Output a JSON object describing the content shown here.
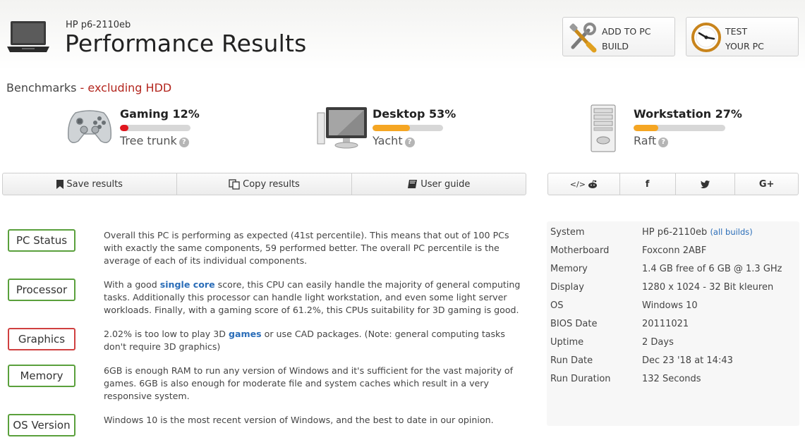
{
  "header": {
    "device_name": "HP p6-2110eb",
    "title": "Performance Results",
    "add_to_pc_build": "ADD TO PC\nBUILD",
    "test_your_pc": "TEST\nYOUR PC"
  },
  "benchmarks": {
    "heading": "Benchmarks",
    "separator": " - ",
    "excluding": "excluding HDD",
    "items": [
      {
        "title": "Gaming 12%",
        "percent": 12,
        "color": "#e0171e",
        "rank": "Tree trunk"
      },
      {
        "title": "Desktop 53%",
        "percent": 53,
        "color": "#f5a623",
        "rank": "Yacht"
      },
      {
        "title": "Workstation 27%",
        "percent": 27,
        "color": "#f5a623",
        "rank": "Raft"
      }
    ],
    "help_glyph": "?"
  },
  "toolbar": {
    "save": "Save results",
    "copy": "Copy results",
    "guide": "User guide"
  },
  "share": {
    "embed": "</>",
    "facebook": "f",
    "google": "G+"
  },
  "status": [
    {
      "label": "PC Status",
      "state": "good",
      "parts": [
        {
          "t": "Overall this PC is performing as expected (41st percentile). This means that out of 100 PCs with exactly the same components, 59 performed better. The overall PC percentile is the average of each of its individual components."
        }
      ]
    },
    {
      "label": "Processor",
      "state": "good",
      "parts": [
        {
          "t": "With a good "
        },
        {
          "t": "single core",
          "link": true
        },
        {
          "t": " score, this CPU can easily handle the majority of general computing tasks. Additionally this processor can handle light workstation, and even some light server workloads. Finally, with a gaming score of 61.2%, this CPUs suitability for 3D gaming is good."
        }
      ]
    },
    {
      "label": "Graphics",
      "state": "bad",
      "parts": [
        {
          "t": "2.02% is too low to play 3D "
        },
        {
          "t": "games",
          "link": true
        },
        {
          "t": " or use CAD packages. (Note: general computing tasks don't require 3D graphics)"
        }
      ]
    },
    {
      "label": "Memory",
      "state": "good",
      "parts": [
        {
          "t": "6GB is enough RAM to run any version of Windows and it's sufficient for the vast majority of games. 6GB is also enough for moderate file and system caches which result in a very responsive system."
        }
      ]
    },
    {
      "label": "OS Version",
      "state": "good",
      "parts": [
        {
          "t": "Windows 10 is the most recent version of Windows, and the best to date in our opinion."
        }
      ]
    }
  ],
  "specs": {
    "all_builds": "(all builds)",
    "rows": [
      {
        "key": "System",
        "value": "HP p6-2110eb"
      },
      {
        "key": "Motherboard",
        "value": "Foxconn 2ABF"
      },
      {
        "key": "Memory",
        "value": "1.4 GB free of 6 GB @ 1.3 GHz"
      },
      {
        "key": "Display",
        "value": "1280 x 1024 - 32 Bit kleuren"
      },
      {
        "key": "OS",
        "value": "Windows 10"
      },
      {
        "key": "BIOS Date",
        "value": "20111021"
      },
      {
        "key": "Uptime",
        "value": "2 Days"
      },
      {
        "key": "Run Date",
        "value": "Dec 23 '18 at 14:43"
      },
      {
        "key": "Run Duration",
        "value": "132 Seconds"
      }
    ]
  }
}
